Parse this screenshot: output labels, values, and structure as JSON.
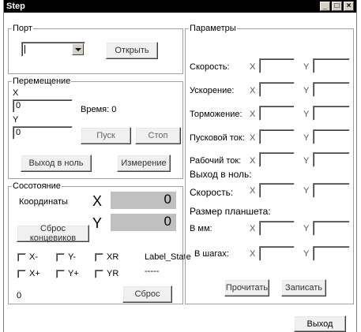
{
  "window": {
    "title": "Step"
  },
  "port": {
    "legend": "Порт",
    "combo_value": "",
    "open_button": "Открыть"
  },
  "movement": {
    "legend": "Перемещение",
    "x_label": "X",
    "x_value": "0",
    "time_label": "Время: 0",
    "y_label": "Y",
    "y_value": "0",
    "start_button": "Пуск",
    "stop_button": "Стоп",
    "home_button": "Выход в ноль",
    "measure_button": "Измерение"
  },
  "state": {
    "legend": "Сосотояние",
    "coords_label": "Координаты",
    "x_letter": "X",
    "x_value": "0",
    "y_letter": "Y",
    "y_value": "0",
    "reset_limits_button": "Сброс концевиков",
    "checkboxes": [
      "X-",
      "Y-",
      "XR",
      "X+",
      "Y+",
      "YR"
    ],
    "label_state": "Label_State",
    "dashes": "-----",
    "counter": "0",
    "reset_button": "Сброс"
  },
  "params": {
    "legend": "Параметры",
    "rows": [
      {
        "label": "Скорость:",
        "x": "X",
        "y": "Y"
      },
      {
        "label": "Ускорение:",
        "x": "X",
        "y": "Y"
      },
      {
        "label": "Торможение:",
        "x": "X",
        "y": "Y"
      },
      {
        "label": "Пусковой ток:",
        "x": "X",
        "y": "Y"
      },
      {
        "label": "Рабочий ток:",
        "x": "X",
        "y": "Y"
      }
    ],
    "home_header": "Выход в ноль:",
    "home_speed_label": "Скорость:",
    "home_speed_x": "X",
    "home_speed_y": "Y",
    "tablet_header": "Размер планшета:",
    "mm_label": "В мм:",
    "mm_x": "X",
    "mm_y": "Y",
    "steps_label": "В шагах:",
    "steps_x": "X",
    "steps_y": "Y",
    "read_button": "Прочитать",
    "write_button": "Записать"
  },
  "exit_button": "Выход"
}
